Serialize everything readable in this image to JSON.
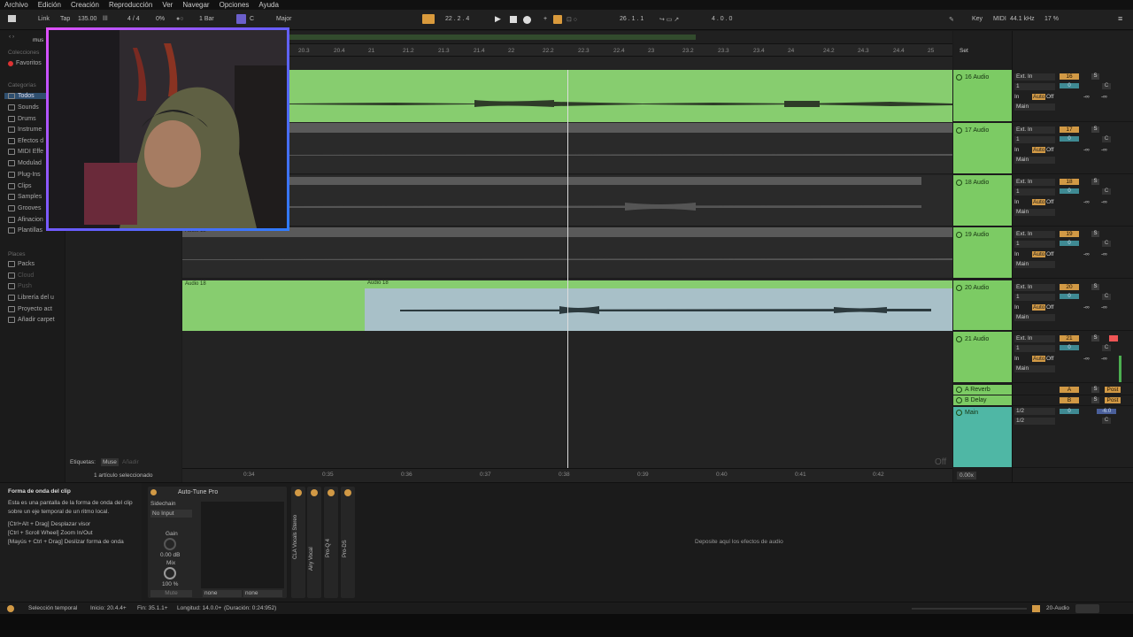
{
  "menu": [
    "Archivo",
    "Edición",
    "Creación",
    "Reproducción",
    "Ver",
    "Navegar",
    "Opciones",
    "Ayuda"
  ],
  "transport": {
    "link": "Link",
    "tap": "Tap",
    "tempo": "135.00",
    "sig": "4 / 4",
    "percent": "0%",
    "quant": "1 Bar",
    "key": "C",
    "scale": "Major",
    "position": "22 . 2 . 4",
    "loop_start": "26 . 1 . 1",
    "loop_len": "4 . 0 . 0",
    "key_label": "Key",
    "midi_label": "MIDI",
    "samplerate": "44.1 kHz",
    "cpu": "17 %"
  },
  "browser": {
    "search": "mus",
    "collections_title": "Colecciones",
    "collections": [
      "Favoritos"
    ],
    "categories_title": "Categorías",
    "categories": [
      "Todos",
      "Sounds",
      "Drums",
      "Instrume",
      "Efectos d",
      "MIDI Effe",
      "Modulad",
      "Plug-Ins",
      "Clips",
      "Samples",
      "Grooves",
      "Afinacion",
      "Plantillas"
    ],
    "places_title": "Places",
    "places": [
      "Packs",
      "Cloud",
      "Push",
      "Librería del u",
      "Proyecto act",
      "Añadir carpet"
    ],
    "tags_label": "Etiquetas:",
    "tag": "Muse",
    "tag_add": "Añadir",
    "selection": "1 artículo seleccionado"
  },
  "ruler": [
    "20.3",
    "20.4",
    "21",
    "21.2",
    "21.3",
    "21.4",
    "22",
    "22.2",
    "22.3",
    "22.4",
    "23",
    "23.2",
    "23.3",
    "23.4",
    "24",
    "24.2",
    "24.3",
    "24.4",
    "25"
  ],
  "ruler_set": "Set",
  "time_ruler": [
    "0:34",
    "0:35",
    "0:36",
    "0:37",
    "0:38",
    "0:39",
    "0:40",
    "0:41",
    "0:42"
  ],
  "clips": {
    "audio12": "Audio 12",
    "audio18a": "Audio 18",
    "audio18b": "Audio 18"
  },
  "off_label": "Off",
  "tracks": [
    {
      "name": "16 Audio",
      "num": "16",
      "vol": "0"
    },
    {
      "name": "17 Audio",
      "num": "17",
      "vol": "0"
    },
    {
      "name": "18 Audio",
      "num": "18",
      "vol": "0"
    },
    {
      "name": "19 Audio",
      "num": "19",
      "vol": "0"
    },
    {
      "name": "20 Audio",
      "num": "20",
      "vol": "0"
    },
    {
      "name": "21 Audio",
      "num": "21",
      "vol": "0"
    }
  ],
  "returns": [
    {
      "name": "A Reverb",
      "letter": "A"
    },
    {
      "name": "B Delay",
      "letter": "B"
    }
  ],
  "main": {
    "name": "Main",
    "in1": "1/2",
    "in2": "1/2",
    "vol": "0",
    "pan": "-6.0"
  },
  "mixer_labels": {
    "ext_in": "Ext. In",
    "ch": "1",
    "in": "In",
    "auto": "Auto",
    "off": "Off",
    "main": "Main",
    "s": "S",
    "c": "C",
    "inf": "-∞",
    "post": "Post"
  },
  "arr_zoom": "0.00x",
  "detail": {
    "info_title": "Forma de onda del clip",
    "info_body": "Esta es una pantalla de la forma de onda del clip sobre un eje temporal de un ritmo local.",
    "info_h1": "[Ctrl+Alt + Drag] Desplazar visor",
    "info_h2": "[Ctrl + Scroll Wheel] Zoom In/Out",
    "info_h3": "[Mayús + Ctrl + Drag] Deslizar forma de onda",
    "device_name": "Auto-Tune Pro",
    "sidechain": "Sidechain",
    "no_input": "No Input",
    "gain": "Gain",
    "gain_val": "0.00 dB",
    "mix": "Mix",
    "mix_val": "100 %",
    "mute": "Mute",
    "none1": "none",
    "none2": "none",
    "strips": [
      "CLA Vocals Stereo",
      "Airy Vocal",
      "Pro-Q 4",
      "Pro-DS"
    ],
    "drop": "Deposite aquí los efectos de audio"
  },
  "status": {
    "sel": "Selección temporal",
    "start": "Inicio: 20.4.4+",
    "end": "Fin: 35.1.1+",
    "length": "Longitud: 14.0.0+",
    "duration": "(Duración: 0:24:952)",
    "track": "20-Audio"
  }
}
